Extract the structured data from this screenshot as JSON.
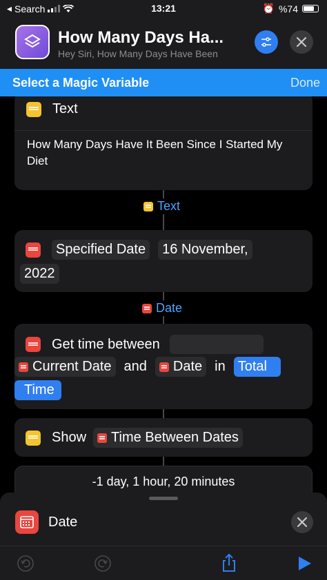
{
  "status_bar": {
    "back_app": "Search",
    "time": "13:21",
    "battery": "%74"
  },
  "header": {
    "title": "How Many Days Ha...",
    "subtitle": "Hey Siri, How Many Days Have Been"
  },
  "magic_bar": {
    "label": "Select a Magic Variable",
    "done": "Done"
  },
  "actions": {
    "text_action": {
      "title": "Text",
      "body": "How Many Days Have It Been Since I Started My Diet",
      "output": "Text"
    },
    "date_action": {
      "label": "Specified Date",
      "value_part1": "16 November,",
      "value_part2": "2022",
      "output": "Date"
    },
    "time_between": {
      "label": "Get time between",
      "first_var": "Current Date",
      "and": "and",
      "second_var": "Date",
      "in": "in",
      "unit_part1": "Total",
      "unit_part2": "Time"
    },
    "show": {
      "label": "Show",
      "var": "Time Between Dates"
    },
    "result": "-1 day, 1 hour, 20 minutes"
  },
  "sheet": {
    "label": "Date"
  },
  "icons": {
    "text": "text-icon",
    "date": "calendar-icon",
    "show": "quicklook-icon"
  },
  "colors": {
    "accent": "#2f7ff0",
    "magic_bar": "#1f8ff5",
    "calendar": "#e8463f",
    "text": "#f4c430"
  }
}
